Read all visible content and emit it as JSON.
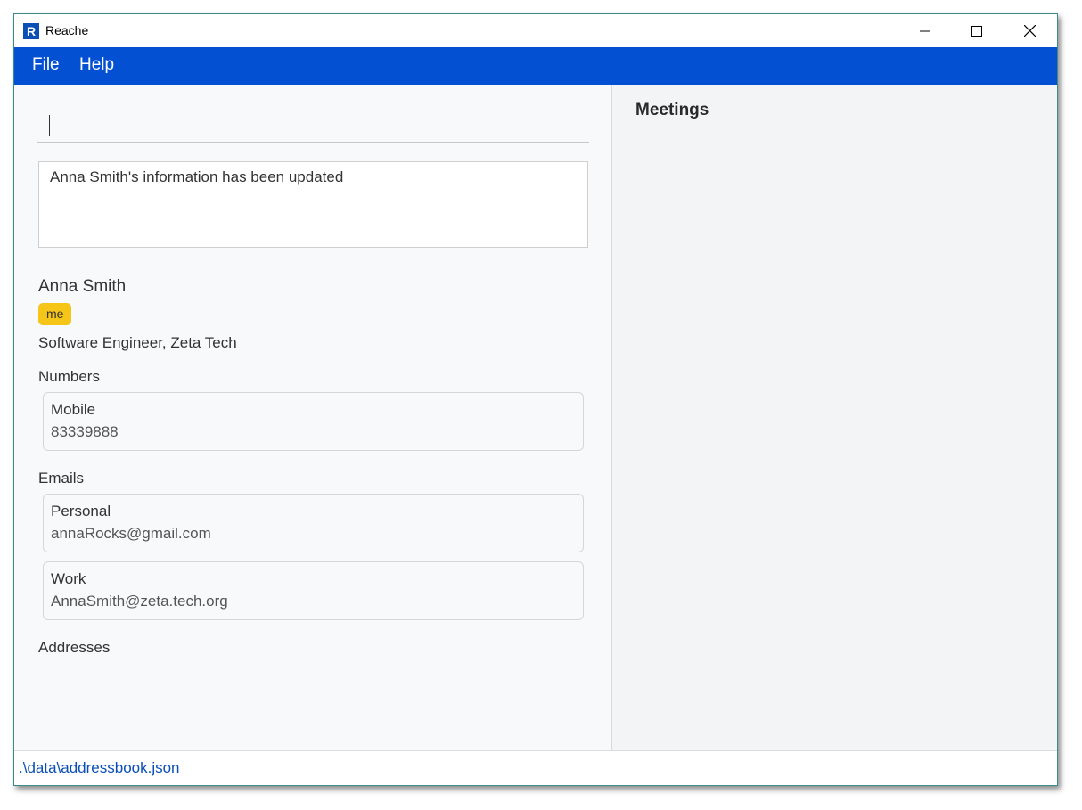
{
  "window": {
    "title": "Reache",
    "logo_letter": "R"
  },
  "menu": {
    "items": [
      "File",
      "Help"
    ]
  },
  "command": {
    "value": ""
  },
  "result": {
    "message": "Anna Smith's information has been updated"
  },
  "person": {
    "name": "Anna Smith",
    "tag": "me",
    "job": "Software Engineer, Zeta Tech",
    "numbers_label": "Numbers",
    "numbers": [
      {
        "label": "Mobile",
        "value": "83339888"
      }
    ],
    "emails_label": "Emails",
    "emails": [
      {
        "label": "Personal",
        "value": "annaRocks@gmail.com"
      },
      {
        "label": "Work",
        "value": "AnnaSmith@zeta.tech.org"
      }
    ],
    "addresses_label": "Addresses"
  },
  "meetings": {
    "title": "Meetings"
  },
  "status": {
    "path": ".\\data\\addressbook.json"
  },
  "colors": {
    "accent": "#0350d2",
    "tag": "#f5c518",
    "status_text": "#0a4fb6"
  }
}
